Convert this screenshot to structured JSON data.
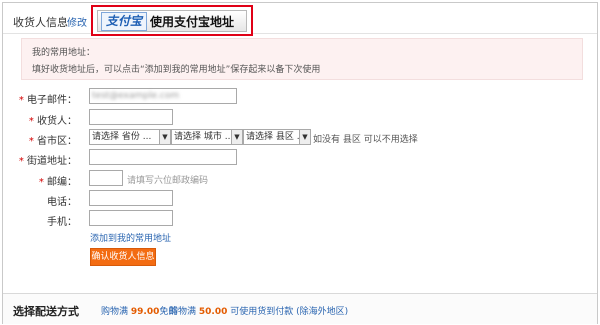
{
  "header": {
    "title": "收货人信息",
    "modify_link": "修改",
    "alipay_logo": "支付宝",
    "alipay_button": "使用支付宝地址"
  },
  "notice": {
    "line1": "我的常用地址：",
    "line2": "填好收货地址后，可以点击“添加到我的常用地址”保存起来以备下次使用"
  },
  "form": {
    "email": {
      "label": "电子邮件：",
      "value": "test@example.com"
    },
    "recipient": {
      "label": "收货人：",
      "value": ""
    },
    "region": {
      "label": "省市区：",
      "province": "请选择 省份 ...",
      "city": "请选择 城市 ...",
      "district": "请选择 县区 ...",
      "hint": "如没有 县区 可以不用选择"
    },
    "street": {
      "label": "街道地址：",
      "value": ""
    },
    "postcode": {
      "label": "邮编：",
      "value": "",
      "hint": "请填写六位邮政编码"
    },
    "phone": {
      "label": "电话：",
      "value": ""
    },
    "mobile": {
      "label": "手机：",
      "value": ""
    },
    "required_mark": "*",
    "add_link": "添加到我的常用地址",
    "confirm_button": "确认收货人信息"
  },
  "shipping": {
    "title": "选择配送方式",
    "free_prefix": "购物满",
    "free_amount": "99.00",
    "free_suffix": "免邮",
    "cod_prefix": "购物满",
    "cod_amount": "50.00",
    "cod_suffix": "可使用货到付款 (除海外地区)"
  }
}
